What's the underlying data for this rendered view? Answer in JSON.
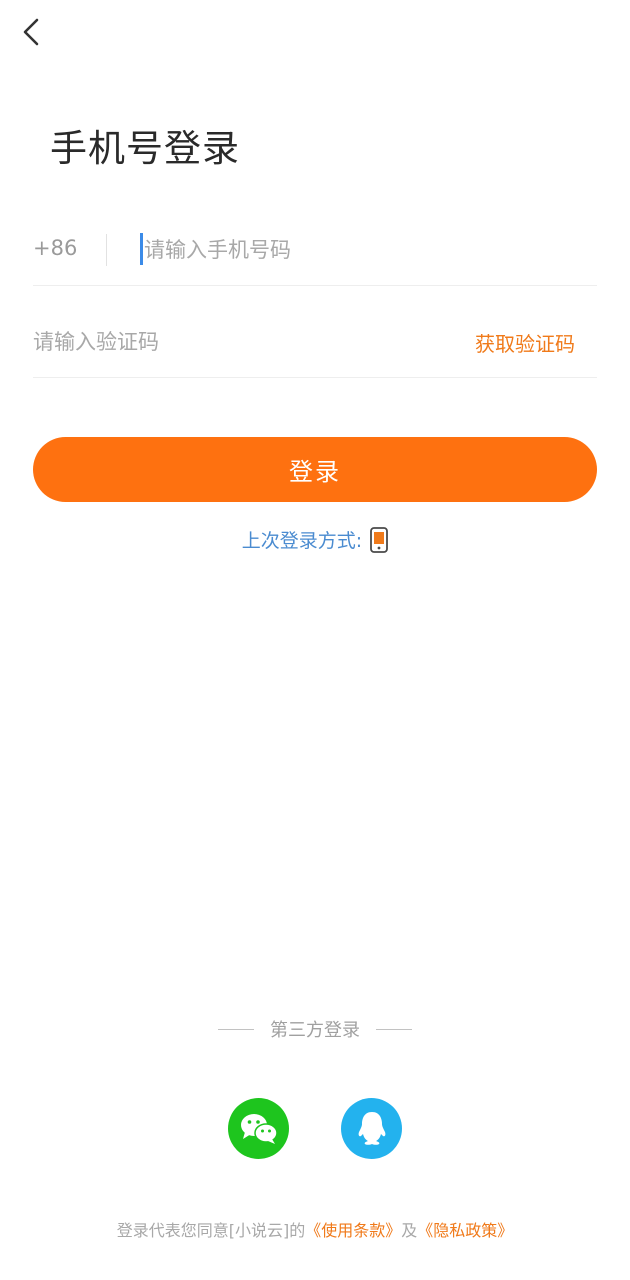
{
  "header": {
    "back_icon": "chevron-left-icon"
  },
  "title": "手机号登录",
  "phone": {
    "country_code": "+86",
    "placeholder": "请输入手机号码",
    "value": ""
  },
  "verification": {
    "placeholder": "请输入验证码",
    "value": "",
    "get_code_label": "获取验证码"
  },
  "login_button": "登录",
  "last_login": {
    "label": "上次登录方式:",
    "icon": "phone-icon"
  },
  "third_party": {
    "label": "第三方登录",
    "options": [
      "wechat-icon",
      "qq-icon"
    ]
  },
  "agreement": {
    "prefix": "登录代表您同意[小说云]的",
    "terms": "《使用条款》",
    "conjunction": "及",
    "privacy": "《隐私政策》"
  },
  "colors": {
    "accent": "#fe7110",
    "link_orange": "#f07a1a",
    "link_blue": "#4a8bd0",
    "wechat": "#1ec51e",
    "qq": "#23b2ee"
  }
}
